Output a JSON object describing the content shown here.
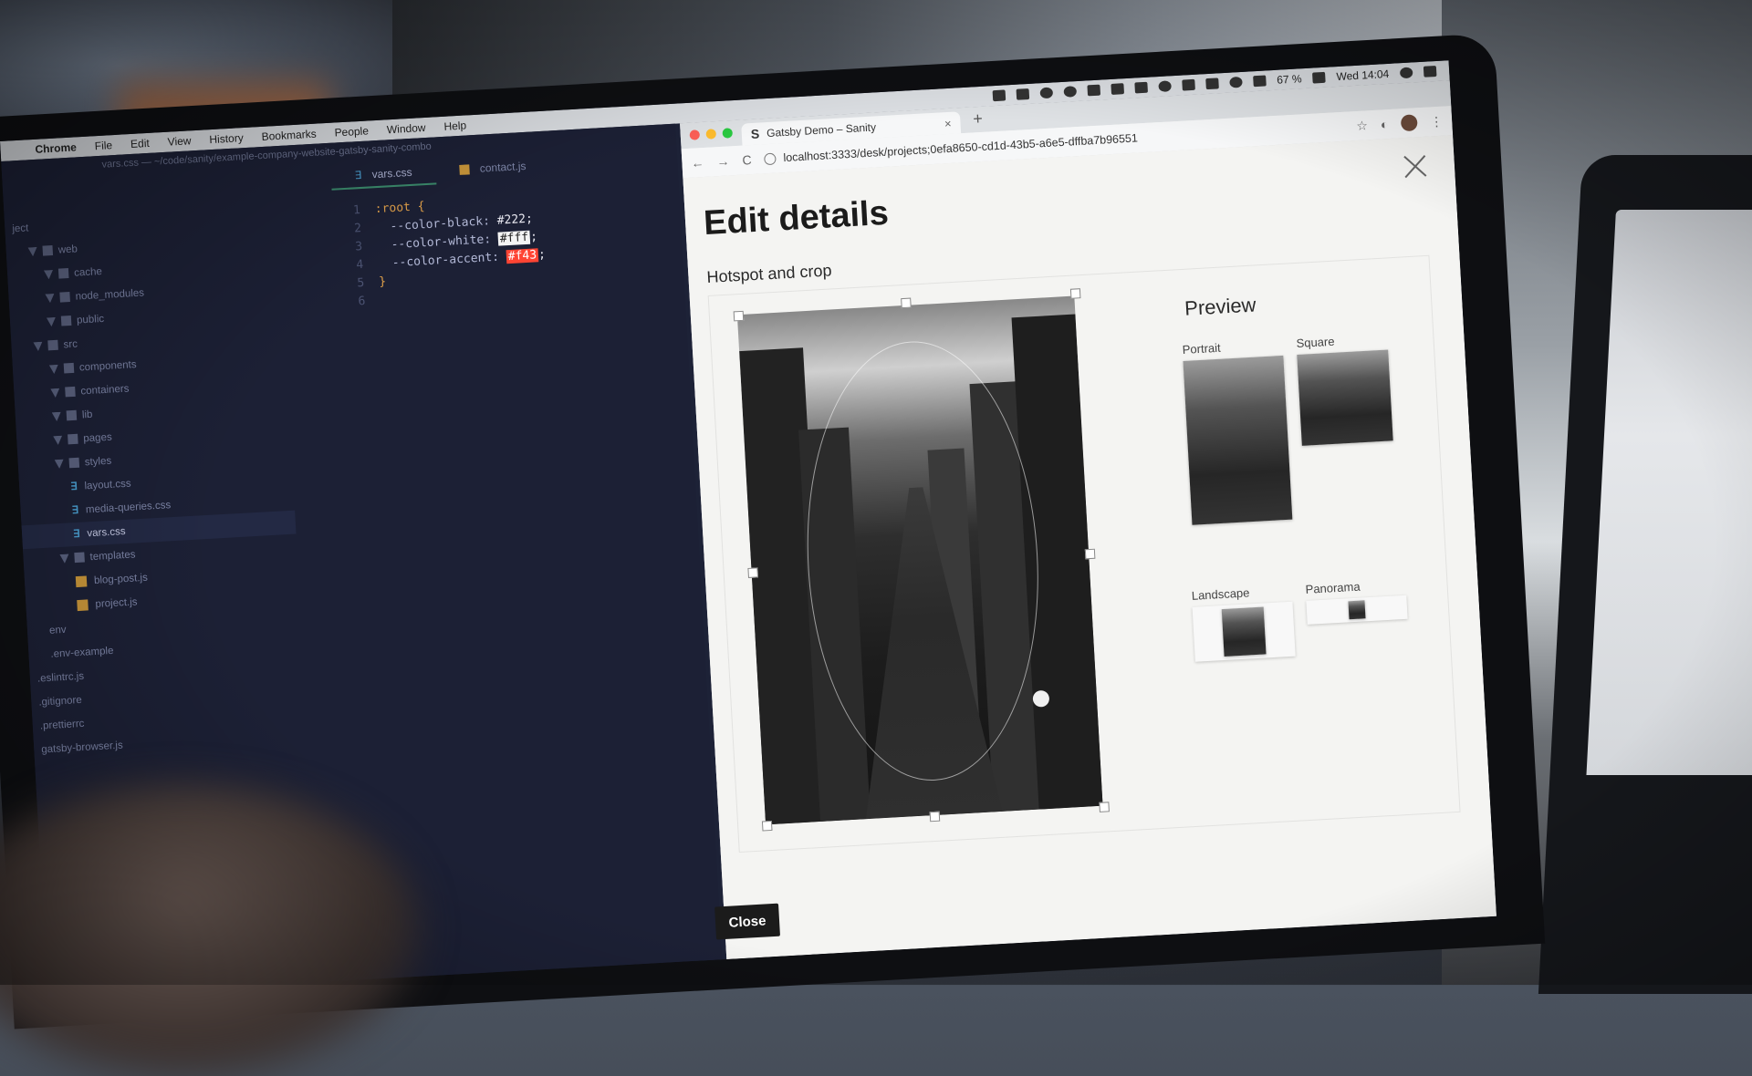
{
  "menubar": {
    "app": "Chrome",
    "items": [
      "File",
      "Edit",
      "View",
      "History",
      "Bookmarks",
      "People",
      "Window",
      "Help"
    ],
    "battery": "67 %",
    "clock": "Wed 14:04"
  },
  "editor": {
    "path": "vars.css — ~/code/sanity/example-company-website-gatsby-sanity-combo",
    "tabs": [
      {
        "label": "vars.css",
        "active": true
      },
      {
        "label": "contact.js",
        "active": false
      }
    ],
    "tree": [
      {
        "label": "ject",
        "indent": 0,
        "type": "text"
      },
      {
        "label": "web",
        "indent": 1,
        "type": "folder"
      },
      {
        "label": "cache",
        "indent": 2,
        "type": "folder"
      },
      {
        "label": "node_modules",
        "indent": 2,
        "type": "folder"
      },
      {
        "label": "public",
        "indent": 2,
        "type": "folder"
      },
      {
        "label": "src",
        "indent": 1,
        "type": "folder"
      },
      {
        "label": "components",
        "indent": 2,
        "type": "folder"
      },
      {
        "label": "containers",
        "indent": 2,
        "type": "folder"
      },
      {
        "label": "lib",
        "indent": 2,
        "type": "folder"
      },
      {
        "label": "pages",
        "indent": 2,
        "type": "folder"
      },
      {
        "label": "styles",
        "indent": 2,
        "type": "folder"
      },
      {
        "label": "layout.css",
        "indent": 3,
        "type": "css"
      },
      {
        "label": "media-queries.css",
        "indent": 3,
        "type": "css"
      },
      {
        "label": "vars.css",
        "indent": 3,
        "type": "css",
        "active": true
      },
      {
        "label": "templates",
        "indent": 2,
        "type": "folder"
      },
      {
        "label": "blog-post.js",
        "indent": 3,
        "type": "js"
      },
      {
        "label": "project.js",
        "indent": 3,
        "type": "js"
      },
      {
        "label": "env",
        "indent": 1,
        "type": "text"
      },
      {
        "label": ".env-example",
        "indent": 1,
        "type": "text"
      },
      {
        "label": ".eslintrc.js",
        "indent": 0,
        "type": "text"
      },
      {
        "label": ".gitignore",
        "indent": 0,
        "type": "text"
      },
      {
        "label": ".prettierrc",
        "indent": 0,
        "type": "text"
      },
      {
        "label": "gatsby-browser.js",
        "indent": 0,
        "type": "text"
      }
    ],
    "code": [
      {
        "n": "1",
        "sel": ":root {"
      },
      {
        "n": "2",
        "prop": "--color-black:",
        "val": "#222;"
      },
      {
        "n": "3",
        "prop": "--color-white:",
        "val": "#fff",
        "swatch": "white"
      },
      {
        "n": "4",
        "prop": "--color-accent:",
        "val": "#f43",
        "swatch": "accent"
      },
      {
        "n": "5",
        "sel": "}"
      },
      {
        "n": "6"
      }
    ]
  },
  "browser": {
    "tab_title": "Gatsby Demo – Sanity",
    "tab_favicon": "S",
    "url": "localhost:3333/desk/projects;0efa8650-cd1d-43b5-a6e5-dffba7b96551",
    "nav": {
      "back": "←",
      "forward": "→",
      "reload": "C"
    }
  },
  "dialog": {
    "title": "Edit details",
    "field_title": "Hotspot and crop",
    "preview": {
      "title": "Preview",
      "items": [
        "Portrait",
        "Square",
        "Landscape",
        "Panorama"
      ]
    },
    "close_label": "Close"
  },
  "colors": {
    "accent": "#ff4433",
    "dialog_bg": "#f4f4f2",
    "editor_bg": "#1c2035"
  }
}
